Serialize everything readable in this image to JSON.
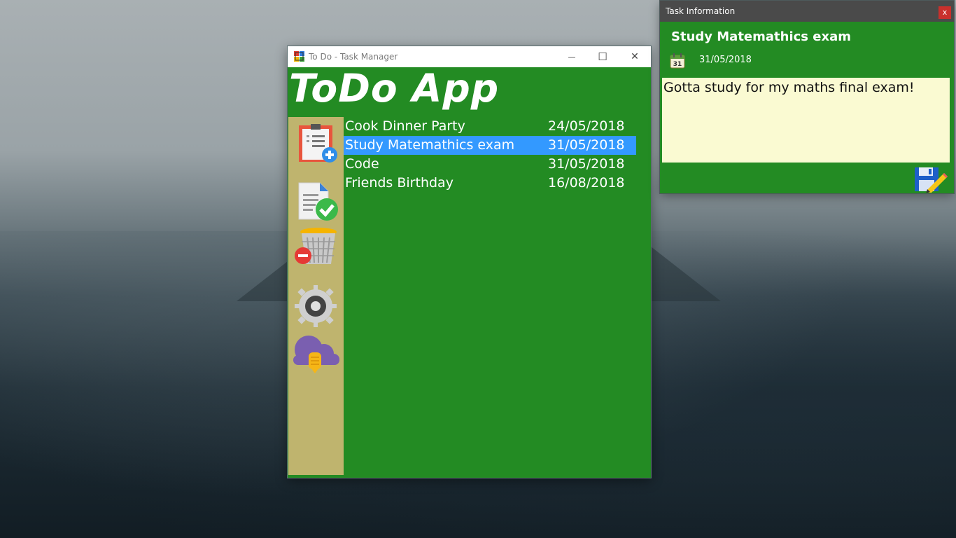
{
  "main_window": {
    "title": "To Do - Task Manager",
    "minimize_glyph": "—",
    "maximize_glyph": "☐",
    "close_glyph": "✕",
    "heading": "ToDo App"
  },
  "sidebar": {
    "items": [
      {
        "name": "add-task-button",
        "icon": "add-task-icon"
      },
      {
        "name": "complete-task-button",
        "icon": "complete-task-icon"
      },
      {
        "name": "delete-task-button",
        "icon": "delete-task-icon"
      },
      {
        "name": "settings-button",
        "icon": "gear-icon"
      },
      {
        "name": "cloud-sync-button",
        "icon": "cloud-icon"
      }
    ]
  },
  "tasks": [
    {
      "name": "Cook Dinner Party",
      "date": "24/05/2018"
    },
    {
      "name": "Study Matemathics exam",
      "date": "31/05/2018"
    },
    {
      "name": "Code",
      "date": "31/05/2018"
    },
    {
      "name": "Friends Birthday",
      "date": "16/08/2018"
    }
  ],
  "info_window": {
    "title": "Task Information",
    "close_label": "x",
    "task_title": "Study Matemathics exam",
    "calendar_day": "31",
    "date": "31/05/2018",
    "notes": "Gotta study for my maths final exam!"
  },
  "colors": {
    "app_green": "#238b23",
    "sidebar": "#bfb46e",
    "selection": "#3399ff",
    "notes_bg": "#fafad2"
  }
}
